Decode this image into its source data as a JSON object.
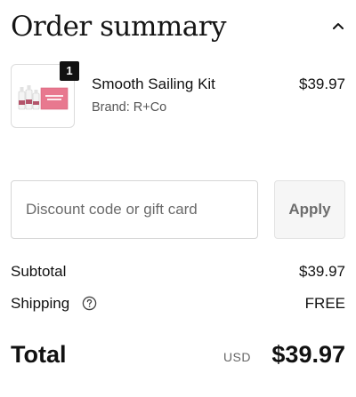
{
  "header": {
    "title": "Order summary",
    "toggle_icon": "chevron-up-icon"
  },
  "line_item": {
    "quantity": "1",
    "name": "Smooth Sailing Kit",
    "brand": "Brand: R+Co",
    "price": "$39.97",
    "image_icon": "product-thumbnail",
    "image_box_text": "SMOOTH SAILING"
  },
  "discount": {
    "placeholder": "Discount code or gift card",
    "value": "",
    "apply_label": "Apply"
  },
  "summary": {
    "subtotal_label": "Subtotal",
    "subtotal_value": "$39.97",
    "shipping_label": "Shipping",
    "shipping_value": "FREE",
    "shipping_help_icon": "question-circle-icon"
  },
  "total": {
    "label": "Total",
    "currency": "USD",
    "amount": "$39.97"
  },
  "colors": {
    "text": "#111111",
    "muted": "#555555",
    "border": "#d6d6d6",
    "button_bg": "#f6f6f6",
    "product_pink": "#e8788f"
  }
}
